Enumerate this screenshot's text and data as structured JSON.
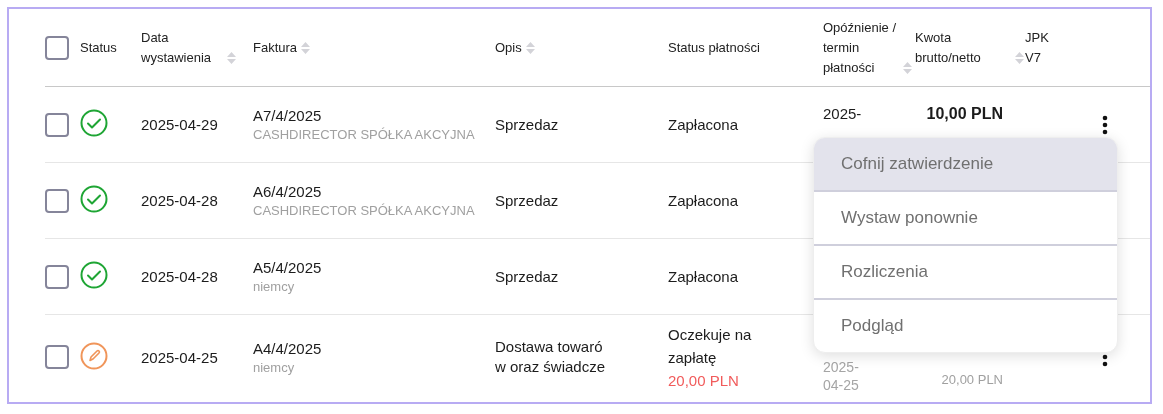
{
  "table": {
    "select_all": {
      "checked": false
    },
    "columns": [
      {
        "label": "Status",
        "sortable": false
      },
      {
        "label": "Data wystawienia",
        "sortable": true
      },
      {
        "label": "Faktura",
        "sortable": true
      },
      {
        "label": "Opis",
        "sortable": true
      },
      {
        "label": "Status płatności",
        "sortable": false
      },
      {
        "label": "Opóźnienie / termin płatności",
        "sortable": true
      },
      {
        "label": "Kwota brutto/netto",
        "sortable": true
      },
      {
        "label": "JPK V7",
        "sortable": false
      }
    ],
    "rows": [
      {
        "checked": false,
        "kind": "approved",
        "date": "2025-04-29",
        "invoice": "A7/4/2025",
        "customer": "CASHDIRECTOR SPÓŁKA AKCYJNA",
        "description": "Sprzedaz",
        "payment_status": "Zapłacona",
        "due": {
          "text": "2025-",
          "muted": false
        },
        "gross": "10,00 PLN",
        "actions": true
      },
      {
        "checked": false,
        "kind": "approved",
        "date": "2025-04-28",
        "invoice": "A6/4/2025",
        "customer": "CASHDIRECTOR SPÓŁKA AKCYJNA",
        "description": "Sprzedaz",
        "payment_status": "Zapłacona",
        "actions": false
      },
      {
        "checked": false,
        "kind": "approved",
        "date": "2025-04-28",
        "invoice": "A5/4/2025",
        "customer": "niemcy",
        "description": "Sprzedaz",
        "payment_status": "Zapłacona",
        "actions": false
      },
      {
        "checked": false,
        "kind": "draft",
        "date": "2025-04-25",
        "invoice": "A4/4/2025",
        "customer": "niemcy",
        "description": "Dostawa towarów oraz świadcze",
        "payment_status": "Oczekuje na zapłatę",
        "outstanding": "20,00 PLN",
        "due": {
          "text": "2025-04-25",
          "muted": true
        },
        "net": "20,00 PLN",
        "actions": true
      }
    ]
  },
  "context_menu": {
    "items": [
      {
        "label": "Cofnij zatwierdzenie",
        "highlighted": true
      },
      {
        "label": "Wystaw ponownie",
        "highlighted": false
      },
      {
        "label": "Rozliczenia",
        "highlighted": false
      },
      {
        "label": "Podgląd",
        "highlighted": false
      }
    ]
  }
}
